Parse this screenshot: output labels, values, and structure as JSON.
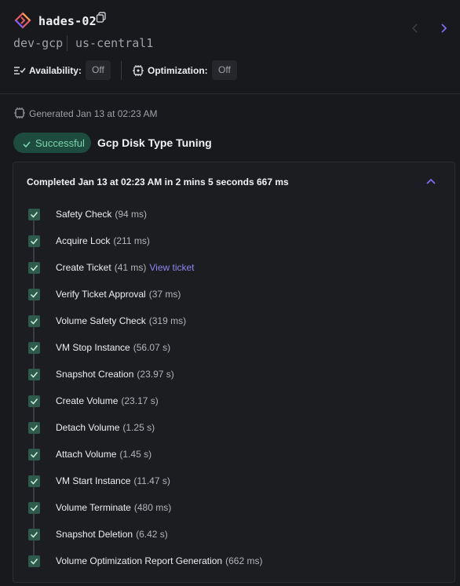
{
  "header": {
    "title": "hades-02",
    "env": "dev-gcp",
    "region": "us-central1",
    "availability_label": "Availability:",
    "availability_value": "Off",
    "optimization_label": "Optimization:",
    "optimization_value": "Off"
  },
  "run": {
    "generated": "Generated Jan 13 at 02:23 AM",
    "status": "Successful",
    "task": "Gcp Disk Type Tuning",
    "completed": "Completed Jan 13 at 02:23 AM in 2 mins 5 seconds 667 ms"
  },
  "steps": [
    {
      "name": "Safety Check",
      "duration": "(94 ms)"
    },
    {
      "name": "Acquire Lock",
      "duration": "(211 ms)"
    },
    {
      "name": "Create Ticket",
      "duration": "(41 ms)",
      "link": "View ticket"
    },
    {
      "name": "Verify Ticket Approval",
      "duration": "(37 ms)"
    },
    {
      "name": "Volume Safety Check",
      "duration": "(319 ms)"
    },
    {
      "name": "VM Stop Instance",
      "duration": "(56.07 s)"
    },
    {
      "name": "Snapshot Creation",
      "duration": "(23.97 s)"
    },
    {
      "name": "Create Volume",
      "duration": "(23.17 s)"
    },
    {
      "name": "Detach Volume",
      "duration": "(1.25 s)"
    },
    {
      "name": "Attach Volume",
      "duration": "(1.45 s)"
    },
    {
      "name": "VM Start Instance",
      "duration": "(11.47 s)"
    },
    {
      "name": "Volume Terminate",
      "duration": "(480 ms)"
    },
    {
      "name": "Snapshot Deletion",
      "duration": "(6.42 s)"
    },
    {
      "name": "Volume Optimization Report Generation",
      "duration": "(662 ms)"
    }
  ],
  "colors": {
    "background": "#18191c",
    "success": "#7fd3ae",
    "success_bg": "#1d4b3d",
    "accent": "#7c6cf2",
    "link": "#8f86f0"
  },
  "icons": [
    "app-logo-icon",
    "copy-icon",
    "chevron-left-icon",
    "chevron-right-icon",
    "availability-icon",
    "optimization-icon",
    "generated-icon",
    "check-icon",
    "chevron-up-icon",
    "checkbox-checked-icon"
  ]
}
